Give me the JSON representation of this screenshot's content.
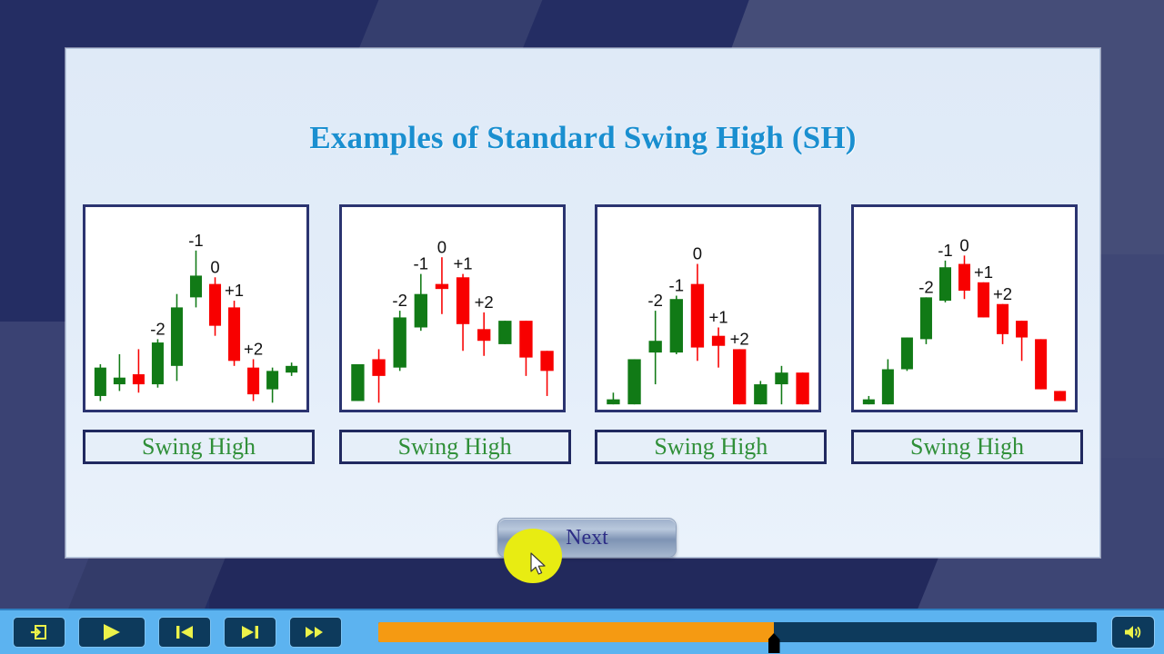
{
  "slide": {
    "title": "Examples of Standard Swing High (SH)",
    "next_label": "Next",
    "colors": {
      "title": "#1a8fd0",
      "label_text": "#2f8f38",
      "frame": "#2b3470",
      "bull": "#117a16",
      "bear": "#f80000",
      "slide_bg": "#dfeaf7",
      "page_bg": "#242d63",
      "toolbar_bg": "#5cb3f0",
      "progress_fill": "#f59a12",
      "highlight": "#e8ec12"
    }
  },
  "panels": [
    {
      "label": "Swing High",
      "chart_data": {
        "type": "candlestick",
        "title": "Swing High example 1",
        "annotations": [
          {
            "text": "-2",
            "bar": 3
          },
          {
            "text": "-1",
            "bar": 5
          },
          {
            "text": "0",
            "bar": 6
          },
          {
            "text": "+1",
            "bar": 7
          },
          {
            "text": "+2",
            "bar": 8
          }
        ],
        "ylim": [
          0,
          100
        ],
        "bars": [
          {
            "o": 22,
            "c": 5,
            "h": 24,
            "l": 2,
            "dir": "up"
          },
          {
            "o": 16,
            "c": 12,
            "h": 30,
            "l": 8,
            "dir": "up"
          },
          {
            "o": 18,
            "c": 12,
            "h": 33,
            "l": 7,
            "dir": "down"
          },
          {
            "o": 37,
            "c": 12,
            "h": 39,
            "l": 10,
            "dir": "up"
          },
          {
            "o": 58,
            "c": 23,
            "h": 66,
            "l": 14,
            "dir": "up"
          },
          {
            "o": 77,
            "c": 64,
            "h": 92,
            "l": 58,
            "dir": "up"
          },
          {
            "o": 72,
            "c": 47,
            "h": 76,
            "l": 41,
            "dir": "down"
          },
          {
            "o": 58,
            "c": 26,
            "h": 62,
            "l": 23,
            "dir": "down"
          },
          {
            "o": 22,
            "c": 6,
            "h": 27,
            "l": 2,
            "dir": "down"
          },
          {
            "o": 20,
            "c": 9,
            "h": 22,
            "l": 1,
            "dir": "up"
          },
          {
            "o": 23,
            "c": 19,
            "h": 25,
            "l": 17,
            "dir": "up"
          }
        ]
      }
    },
    {
      "label": "Swing High",
      "chart_data": {
        "type": "candlestick",
        "title": "Swing High example 2",
        "annotations": [
          {
            "text": "-2",
            "bar": 2
          },
          {
            "text": "-1",
            "bar": 3
          },
          {
            "text": "0",
            "bar": 4
          },
          {
            "text": "+1",
            "bar": 5
          },
          {
            "text": "+2",
            "bar": 6
          }
        ],
        "ylim": [
          0,
          100
        ],
        "bars": [
          {
            "o": 24,
            "c": 2,
            "h": 24,
            "l": 2,
            "dir": "up"
          },
          {
            "o": 27,
            "c": 17,
            "h": 33,
            "l": 1,
            "dir": "down"
          },
          {
            "o": 52,
            "c": 22,
            "h": 56,
            "l": 20,
            "dir": "up"
          },
          {
            "o": 66,
            "c": 46,
            "h": 78,
            "l": 44,
            "dir": "up"
          },
          {
            "o": 72,
            "c": 69,
            "h": 88,
            "l": 54,
            "dir": "down"
          },
          {
            "o": 76,
            "c": 48,
            "h": 78,
            "l": 32,
            "dir": "down"
          },
          {
            "o": 45,
            "c": 38,
            "h": 55,
            "l": 29,
            "dir": "down"
          },
          {
            "o": 50,
            "c": 36,
            "h": 50,
            "l": 36,
            "dir": "up"
          },
          {
            "o": 50,
            "c": 28,
            "h": 50,
            "l": 17,
            "dir": "down"
          },
          {
            "o": 32,
            "c": 20,
            "h": 32,
            "l": 5,
            "dir": "down"
          }
        ]
      }
    },
    {
      "label": "Swing High",
      "chart_data": {
        "type": "candlestick",
        "title": "Swing High example 3",
        "annotations": [
          {
            "text": "-2",
            "bar": 2
          },
          {
            "text": "-1",
            "bar": 3
          },
          {
            "text": "0",
            "bar": 4
          },
          {
            "text": "+1",
            "bar": 5
          },
          {
            "text": "+2",
            "bar": 6
          }
        ],
        "ylim": [
          0,
          100
        ],
        "bars": [
          {
            "o": 3,
            "c": 0,
            "h": 7,
            "l": 0,
            "dir": "up"
          },
          {
            "o": 27,
            "c": 0,
            "h": 27,
            "l": 0,
            "dir": "up"
          },
          {
            "o": 38,
            "c": 31,
            "h": 56,
            "l": 12,
            "dir": "up"
          },
          {
            "o": 63,
            "c": 31,
            "h": 65,
            "l": 30,
            "dir": "up"
          },
          {
            "o": 72,
            "c": 34,
            "h": 84,
            "l": 26,
            "dir": "down"
          },
          {
            "o": 41,
            "c": 35,
            "h": 46,
            "l": 22,
            "dir": "down"
          },
          {
            "o": 33,
            "c": 0,
            "h": 33,
            "l": 0,
            "dir": "down"
          },
          {
            "o": 12,
            "c": 0,
            "h": 14,
            "l": 0,
            "dir": "up"
          },
          {
            "o": 19,
            "c": 12,
            "h": 23,
            "l": 0,
            "dir": "up"
          },
          {
            "o": 19,
            "c": 0,
            "h": 19,
            "l": 0,
            "dir": "down"
          }
        ]
      }
    },
    {
      "label": "Swing High",
      "chart_data": {
        "type": "candlestick",
        "title": "Swing High example 4",
        "annotations": [
          {
            "text": "-2",
            "bar": 3
          },
          {
            "text": "-1",
            "bar": 4
          },
          {
            "text": "0",
            "bar": 5
          },
          {
            "text": "+1",
            "bar": 6
          },
          {
            "text": "+2",
            "bar": 7
          }
        ],
        "ylim": [
          0,
          100
        ],
        "bars": [
          {
            "o": 3,
            "c": 0,
            "h": 5,
            "l": 0,
            "dir": "up"
          },
          {
            "o": 21,
            "c": 0,
            "h": 27,
            "l": 0,
            "dir": "up"
          },
          {
            "o": 40,
            "c": 21,
            "h": 40,
            "l": 20,
            "dir": "up"
          },
          {
            "o": 64,
            "c": 39,
            "h": 64,
            "l": 36,
            "dir": "up"
          },
          {
            "o": 82,
            "c": 62,
            "h": 86,
            "l": 61,
            "dir": "up"
          },
          {
            "o": 84,
            "c": 68,
            "h": 89,
            "l": 63,
            "dir": "down"
          },
          {
            "o": 73,
            "c": 52,
            "h": 73,
            "l": 52,
            "dir": "down"
          },
          {
            "o": 60,
            "c": 42,
            "h": 60,
            "l": 36,
            "dir": "down"
          },
          {
            "o": 50,
            "c": 40,
            "h": 50,
            "l": 26,
            "dir": "down"
          },
          {
            "o": 39,
            "c": 9,
            "h": 39,
            "l": 9,
            "dir": "down"
          },
          {
            "o": 8,
            "c": 2,
            "h": 8,
            "l": 2,
            "dir": "down"
          }
        ]
      }
    }
  ],
  "toolbar": {
    "buttons": [
      {
        "name": "exit-button",
        "icon": "exit-icon"
      },
      {
        "name": "play-button",
        "icon": "play-icon"
      },
      {
        "name": "previous-button",
        "icon": "skip-back-icon"
      },
      {
        "name": "next-slide-button",
        "icon": "skip-forward-icon"
      },
      {
        "name": "fast-forward-button",
        "icon": "fast-forward-icon"
      }
    ],
    "progress_percent": 55,
    "volume_icon": "speaker-icon"
  }
}
